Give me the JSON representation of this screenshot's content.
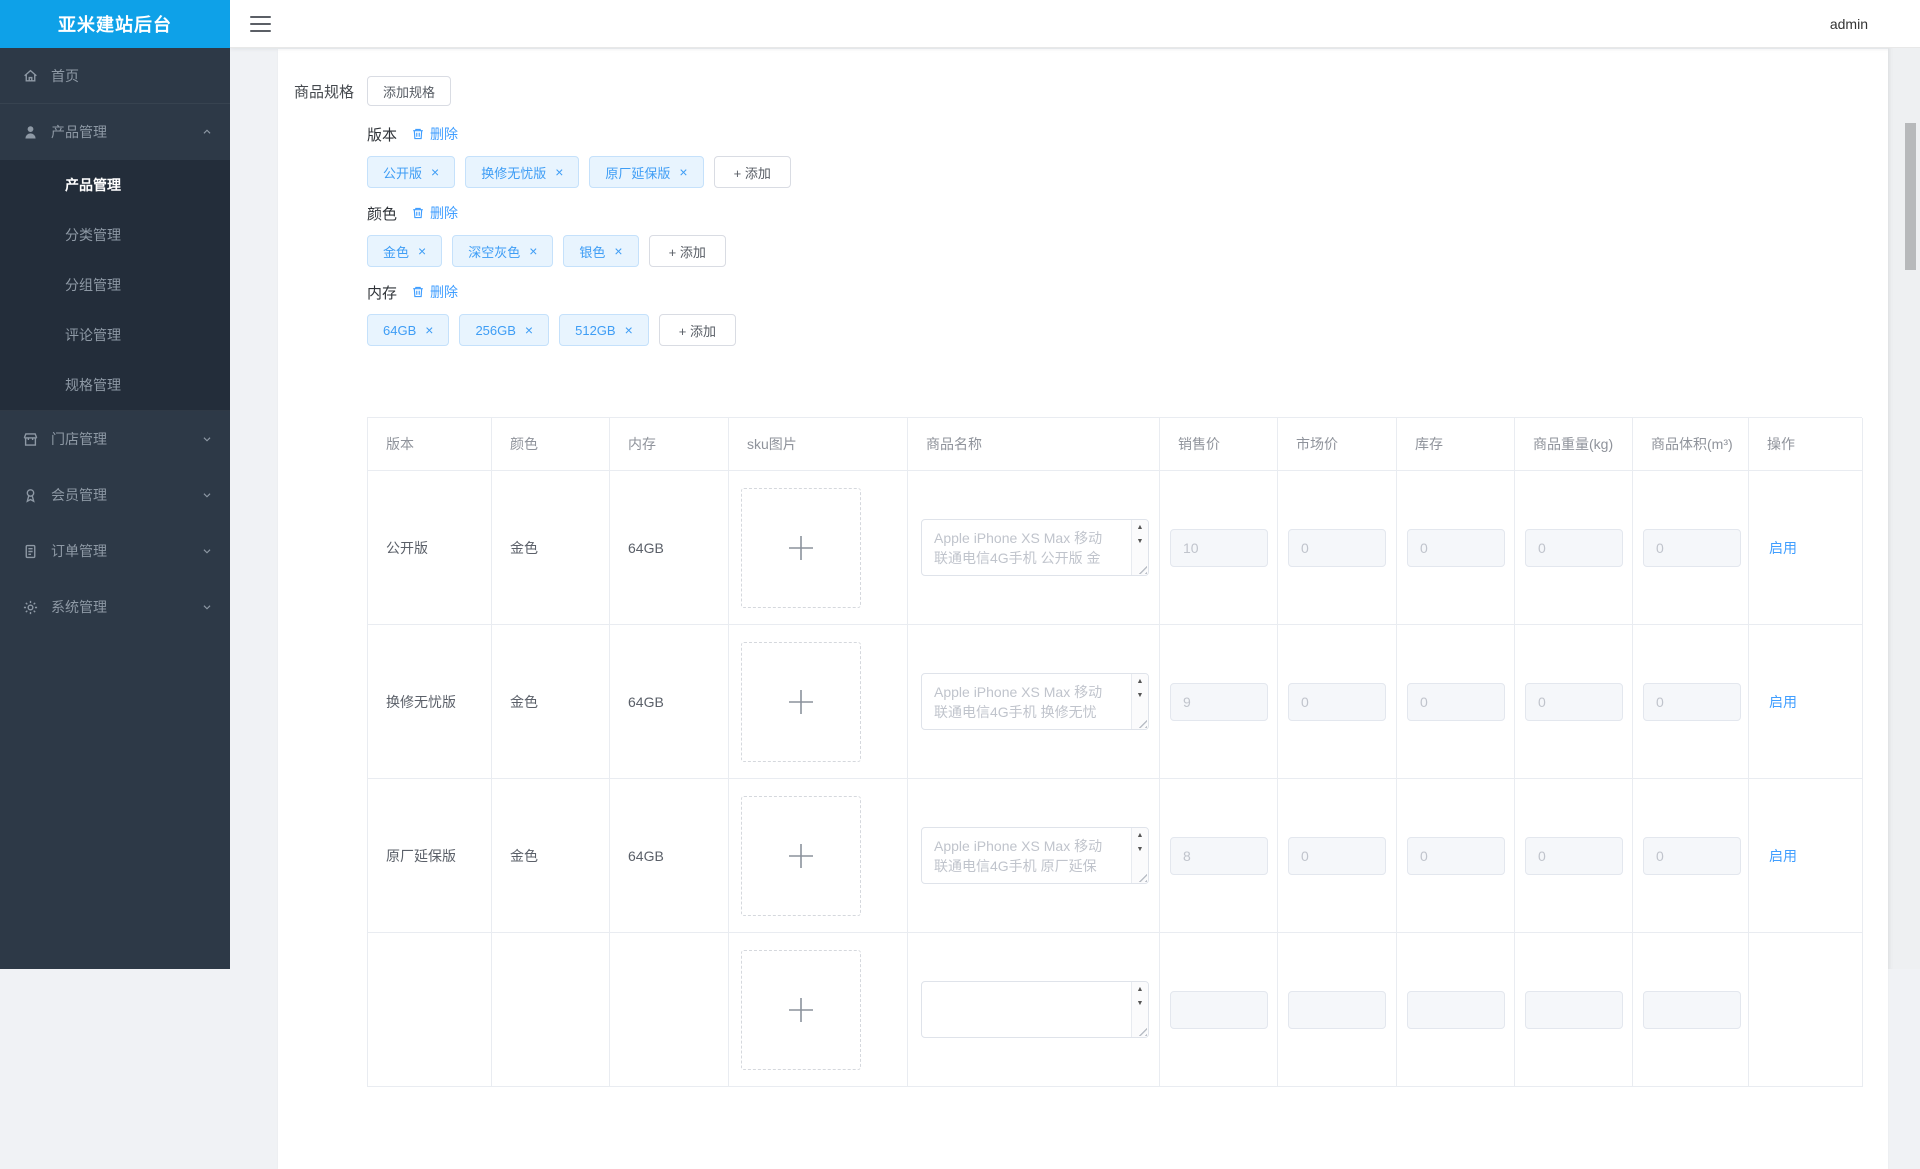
{
  "colors": {
    "accent_blue": "#409eff",
    "brand_blue": "#0ea1e8",
    "sidebar_bg": "#2d3947",
    "tag_bg": "#e8f4fe"
  },
  "app": {
    "logo_title": "亚米建站后台",
    "admin_label": "admin"
  },
  "sidebar": {
    "items": [
      {
        "label": "首页",
        "icon": "home-icon"
      },
      {
        "label": "产品管理",
        "icon": "user-icon",
        "expanded": true,
        "children": [
          {
            "label": "产品管理",
            "active": true
          },
          {
            "label": "分类管理"
          },
          {
            "label": "分组管理"
          },
          {
            "label": "评论管理"
          },
          {
            "label": "规格管理"
          }
        ]
      },
      {
        "label": "门店管理",
        "icon": "store-icon"
      },
      {
        "label": "会员管理",
        "icon": "member-icon"
      },
      {
        "label": "订单管理",
        "icon": "order-icon"
      },
      {
        "label": "系统管理",
        "icon": "gear-icon"
      }
    ]
  },
  "toolbar": {
    "spec_section_label": "商品规格",
    "add_spec_button": "添加规格"
  },
  "specs": [
    {
      "name": "版本",
      "delete_label": "删除",
      "values": [
        "公开版",
        "换修无忧版",
        "原厂延保版"
      ],
      "add_label": "+ 添加"
    },
    {
      "name": "颜色",
      "delete_label": "删除",
      "values": [
        "金色",
        "深空灰色",
        "银色"
      ],
      "add_label": "+ 添加"
    },
    {
      "name": "内存",
      "delete_label": "删除",
      "values": [
        "64GB",
        "256GB",
        "512GB"
      ],
      "add_label": "+ 添加"
    }
  ],
  "table": {
    "headers": [
      "版本",
      "颜色",
      "内存",
      "sku图片",
      "商品名称",
      "销售价",
      "市场价",
      "库存",
      "商品重量(kg)",
      "商品体积(m³)",
      "操作"
    ],
    "rows": [
      {
        "version": "公开版",
        "color": "金色",
        "memory": "64GB",
        "name_line1": "Apple iPhone XS Max 移动",
        "name_line2": "联通电信4G手机 公开版 金",
        "sale_price": "10",
        "market_price": "0",
        "stock": "0",
        "weight": "0",
        "volume": "0",
        "action": "启用"
      },
      {
        "version": "换修无忧版",
        "color": "金色",
        "memory": "64GB",
        "name_line1": "Apple iPhone XS Max 移动",
        "name_line2": "联通电信4G手机 换修无忧",
        "sale_price": "9",
        "market_price": "0",
        "stock": "0",
        "weight": "0",
        "volume": "0",
        "action": "启用"
      },
      {
        "version": "原厂延保版",
        "color": "金色",
        "memory": "64GB",
        "name_line1": "Apple iPhone XS Max 移动",
        "name_line2": "联通电信4G手机 原厂延保",
        "sale_price": "8",
        "market_price": "0",
        "stock": "0",
        "weight": "0",
        "volume": "0",
        "action": "启用"
      },
      {
        "version": "",
        "color": "",
        "memory": "",
        "name_line1": "",
        "name_line2": "",
        "sale_price": "",
        "market_price": "",
        "stock": "",
        "weight": "",
        "volume": "",
        "action": ""
      }
    ]
  }
}
